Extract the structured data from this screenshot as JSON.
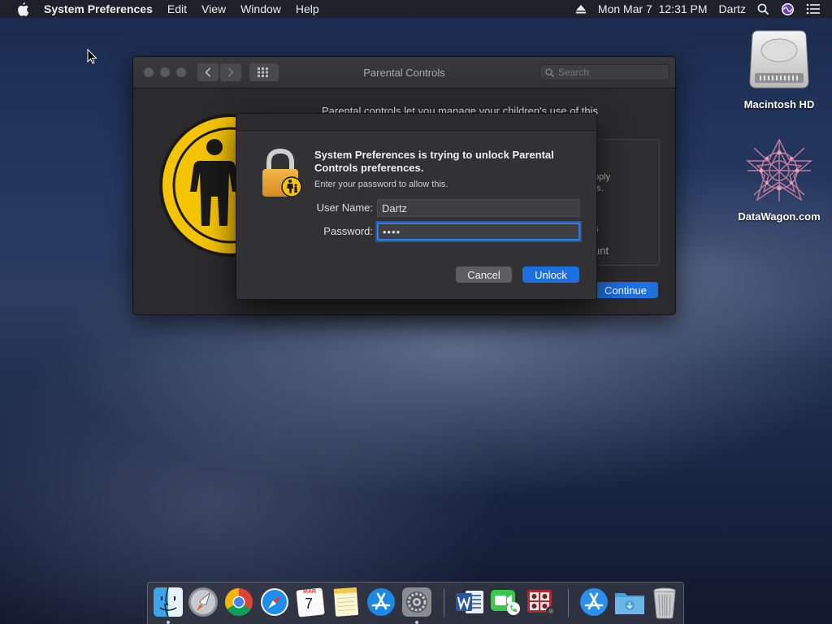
{
  "menubar": {
    "app_name": "System Preferences",
    "menus": [
      "Edit",
      "View",
      "Window",
      "Help"
    ],
    "datetime": "Mon Mar 7  12:31 PM",
    "user": "Dartz"
  },
  "desktop": {
    "icons": [
      {
        "label": "Macintosh HD",
        "icon": "hard-drive-icon"
      },
      {
        "label": "DataWagon.com",
        "icon": "network-graphic-icon"
      }
    ]
  },
  "prefs_window": {
    "title": "Parental Controls",
    "search_placeholder": "Search",
    "intro_text": "Parental controls let you manage your children's use of this",
    "panel_fragments": [
      "pply",
      "ts.",
      "s",
      "unt"
    ],
    "continue_label": "Continue"
  },
  "dialog": {
    "title": "System Preferences is trying to unlock Parental Controls preferences.",
    "subtitle": "Enter your password to allow this.",
    "username_label": "User Name:",
    "username_value": "Dartz",
    "password_label": "Password:",
    "password_value": "••••",
    "cancel_label": "Cancel",
    "unlock_label": "Unlock"
  },
  "calendar": {
    "month": "MAR",
    "day": "7"
  },
  "dock": {
    "items": [
      "finder-icon",
      "launchpad-icon",
      "chrome-icon",
      "safari-icon",
      "calendar-icon",
      "notes-icon",
      "app-store-icon",
      "system-preferences-icon",
      "word-icon",
      "facetime-icon",
      "photo-booth-icon",
      "app-store-folder-icon",
      "downloads-folder-icon",
      "trash-icon"
    ]
  },
  "colors": {
    "accent": "#1e6fe0",
    "parental_yellow": "#f5c400"
  }
}
